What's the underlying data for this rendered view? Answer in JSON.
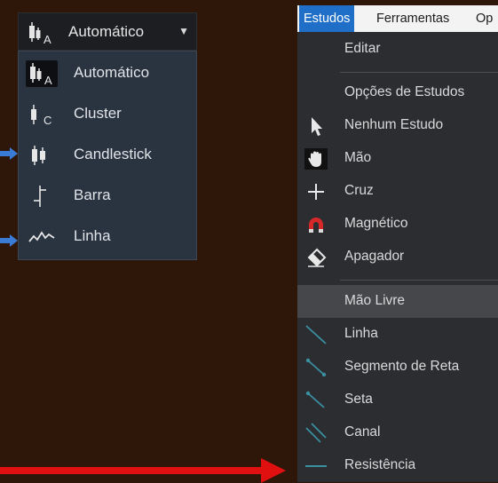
{
  "chart_type_selector": {
    "current_label": "Automático",
    "options": [
      {
        "label": "Automático",
        "icon": "candle-a-icon",
        "selected": true
      },
      {
        "label": "Cluster",
        "icon": "candle-c-icon",
        "selected": false
      },
      {
        "label": "Candlestick",
        "icon": "candlestick-icon",
        "selected": false
      },
      {
        "label": "Barra",
        "icon": "bar-chart-icon",
        "selected": false
      },
      {
        "label": "Linha",
        "icon": "line-chart-icon",
        "selected": false
      }
    ]
  },
  "menubar": {
    "items": [
      "Estudos",
      "Ferramentas",
      "Op"
    ],
    "active": "Estudos"
  },
  "studies_menu": {
    "items": [
      {
        "label": "Editar",
        "icon": ""
      },
      {
        "label": "Opções de Estudos",
        "icon": ""
      },
      {
        "label": "Nenhum Estudo",
        "icon": "cursor-arrow-icon"
      },
      {
        "label": "Mão",
        "icon": "hand-icon"
      },
      {
        "label": "Cruz",
        "icon": "crosshair-icon"
      },
      {
        "label": "Magnético",
        "icon": "magnet-icon"
      },
      {
        "label": "Apagador",
        "icon": "eraser-icon"
      },
      {
        "label": "Mão Livre",
        "icon": "",
        "highlighted": true
      },
      {
        "label": "Linha",
        "icon": "line-tool-icon"
      },
      {
        "label": "Segmento de Reta",
        "icon": "segment-tool-icon"
      },
      {
        "label": "Seta",
        "icon": "arrow-tool-icon"
      },
      {
        "label": "Canal",
        "icon": "channel-tool-icon"
      },
      {
        "label": "Resistência",
        "icon": "resistance-tool-icon"
      }
    ]
  },
  "colors": {
    "background": "#2e1708",
    "menu_active": "#1f6fc8",
    "annotation_blue": "#3a7bd5",
    "annotation_red": "#e01010",
    "tool_line": "#3a8fa0"
  }
}
